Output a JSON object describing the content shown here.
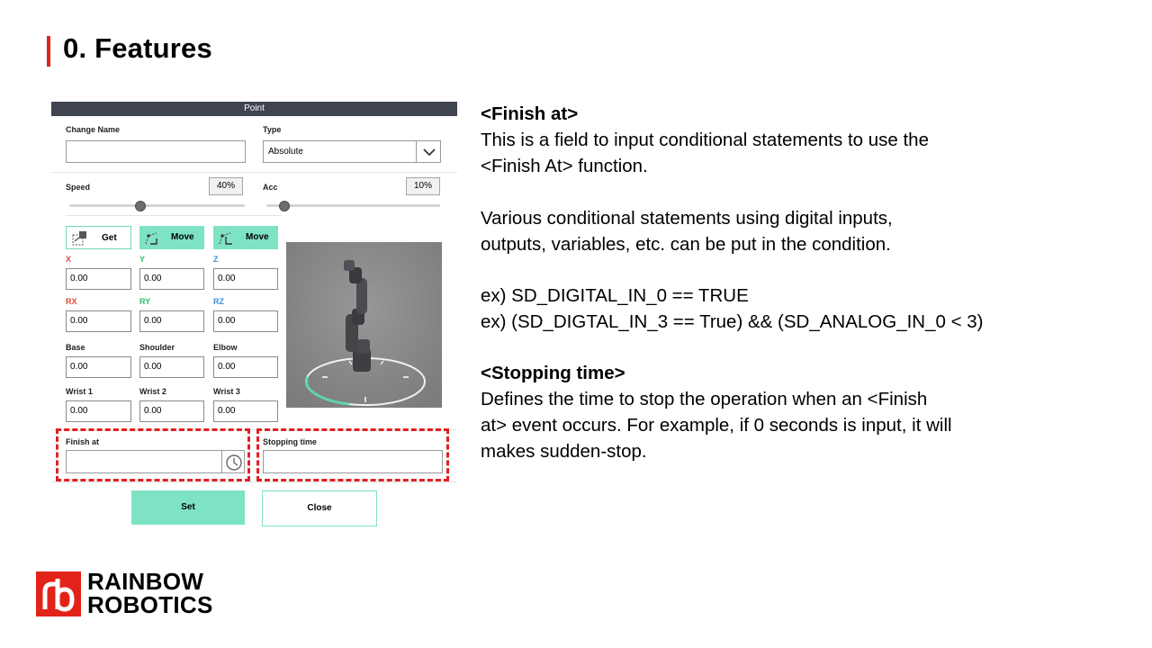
{
  "slide": {
    "title": "0. Features"
  },
  "dialog": {
    "header": "Point",
    "change_name_label": "Change Name",
    "change_name_value": "",
    "type_label": "Type",
    "type_value": "Absolute",
    "speed_label": "Speed",
    "speed_value": "40%",
    "speed_level_percent": 40,
    "acc_label": "Acc",
    "acc_value": "10%",
    "acc_level_percent": 10,
    "get_label": "Get",
    "move_label_1": "Move",
    "move_label_2": "Move",
    "coords": {
      "x_label": "X",
      "x_value": "0.00",
      "y_label": "Y",
      "y_value": "0.00",
      "z_label": "Z",
      "z_value": "0.00",
      "rx_label": "RX",
      "rx_value": "0.00",
      "ry_label": "RY",
      "ry_value": "0.00",
      "rz_label": "RZ",
      "rz_value": "0.00"
    },
    "joints": {
      "base_label": "Base",
      "base_value": "0.00",
      "shoulder_label": "Shoulder",
      "shoulder_value": "0.00",
      "elbow_label": "Elbow",
      "elbow_value": "0.00",
      "wrist1_label": "Wrist 1",
      "wrist1_value": "0.00",
      "wrist2_label": "Wrist 2",
      "wrist2_value": "0.00",
      "wrist3_label": "Wrist 3",
      "wrist3_value": "0.00"
    },
    "finish_at_label": "Finish at",
    "finish_at_value": "",
    "stopping_time_label": "Stopping time",
    "stopping_time_value": "",
    "set_label": "Set",
    "close_label": "Close",
    "colors": {
      "header": "#3f4450",
      "accent": "#7ee3c5",
      "x": "#e04a3a",
      "y": "#2fbf6f",
      "z": "#3a8fe0",
      "highlight": "#e02020"
    }
  },
  "explanation": {
    "finish_heading": "<Finish at>",
    "finish_line1": "This is a field to input conditional statements to use the",
    "finish_line2": "<Finish At> function.",
    "various_line1": "Various conditional statements using digital inputs,",
    "various_line2": "outputs, variables, etc. can be put in the condition.",
    "ex1": "ex) SD_DIGITAL_IN_0 == TRUE",
    "ex2": "ex) (SD_DIGTAL_IN_3 == True) && (SD_ANALOG_IN_0 < 3)",
    "stopping_heading": "<Stopping time>",
    "stopping_line1": "Defines the time to stop the operation when an <Finish",
    "stopping_line2": "at> event occurs. For example, if 0 seconds is input, it will",
    "stopping_line3": "makes sudden-stop."
  },
  "logo": {
    "line1": "RAINBOW",
    "line2": "ROBOTICS",
    "mark": "rb"
  }
}
